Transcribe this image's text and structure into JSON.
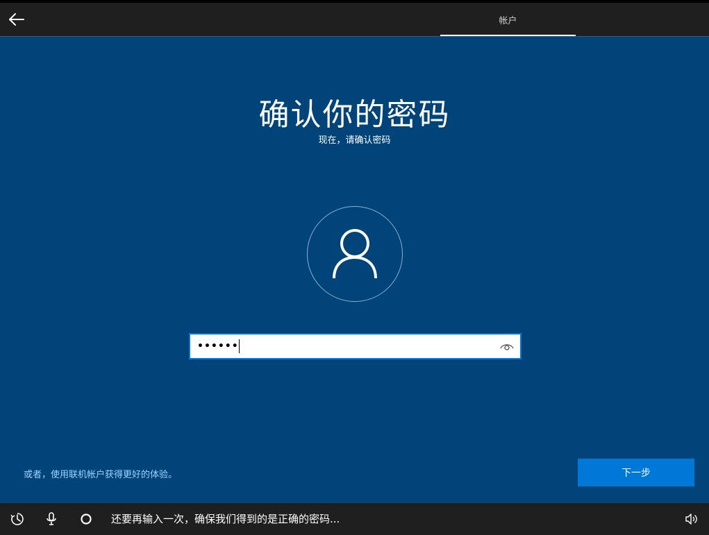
{
  "header": {
    "back_label": "Back",
    "tab_label": "帐户"
  },
  "main": {
    "title": "确认你的密码",
    "subtitle": "现在，请确认密码",
    "avatar_icon": "user-icon",
    "password": {
      "value": "••••••",
      "reveal_icon": "eye-icon"
    },
    "online_link": "或者，使用联机帐户获得更好的体验。",
    "next_label": "下一步"
  },
  "bottom": {
    "icons": [
      "ease-of-access-icon",
      "microphone-icon",
      "cortana-circle-icon",
      "volume-icon"
    ],
    "cortana_text": "还要再输入一次，确保我们得到的是正确的密码..."
  },
  "colors": {
    "background": "#00447a",
    "accent": "#0078d7",
    "bar": "#1f1f1f",
    "link": "#9fd3ff"
  }
}
